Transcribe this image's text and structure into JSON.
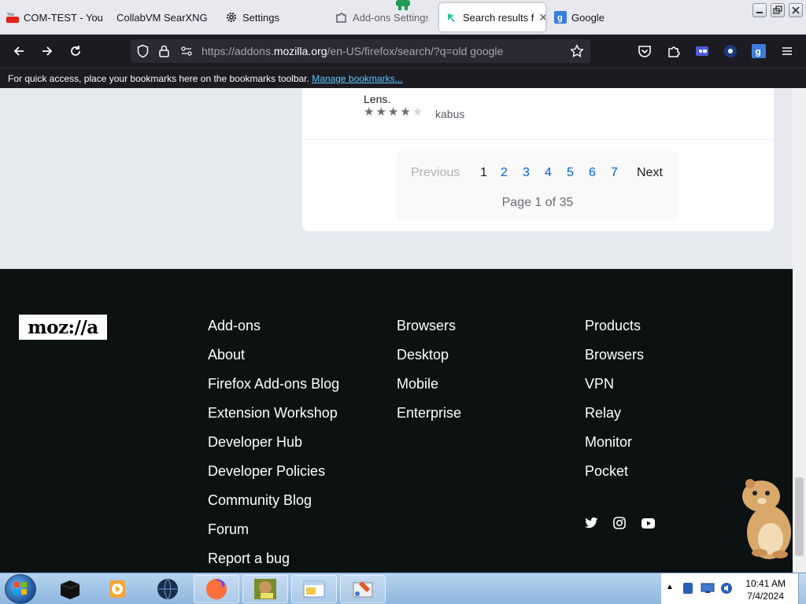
{
  "browser": {
    "tabs": [
      {
        "title": "COM-TEST - You",
        "active": false,
        "favicon": "youtube-icon"
      },
      {
        "title": "CollabVM SearXNG",
        "active": false,
        "favicon": "searxng-icon"
      },
      {
        "title": "Settings",
        "active": false,
        "favicon": "gear-icon"
      },
      {
        "title": "Add-ons Settings",
        "active": false,
        "favicon": "puzzle-icon"
      },
      {
        "title": "Search results f",
        "active": true,
        "favicon": "addons-icon"
      },
      {
        "title": "Google",
        "active": false,
        "favicon": "google-icon"
      }
    ],
    "url": {
      "prefix": "https://addons.",
      "domain": "mozilla.org",
      "path": "/en-US/firefox/search/?q=old google"
    },
    "bookmarks_bar": {
      "message": "For quick access, place your bookmarks here on the bookmarks toolbar.",
      "link": "Manage bookmarks..."
    }
  },
  "result": {
    "description_tail": "Lens.",
    "rating": 4,
    "max_rating": 5,
    "author": "kabus"
  },
  "pagination": {
    "previous": "Previous",
    "current": "1",
    "pages": [
      "2",
      "3",
      "4",
      "5",
      "6",
      "7"
    ],
    "next": "Next",
    "info": "Page 1 of 35"
  },
  "footer": {
    "logo": "moz://a",
    "columns": [
      {
        "links": [
          "Add-ons",
          "About",
          "Firefox Add-ons Blog",
          "Extension Workshop",
          "Developer Hub",
          "Developer Policies",
          "Community Blog",
          "Forum",
          "Report a bug"
        ]
      },
      {
        "links": [
          "Browsers",
          "Desktop",
          "Mobile",
          "Enterprise"
        ]
      },
      {
        "links": [
          "Products",
          "Browsers",
          "VPN",
          "Relay",
          "Monitor",
          "Pocket"
        ]
      }
    ],
    "social": [
      "twitter-icon",
      "instagram-icon",
      "youtube-icon"
    ]
  },
  "taskbar": {
    "clock": {
      "time": "10:41 AM",
      "date": "7/4/2024"
    }
  },
  "colors": {
    "accent": "#0060df",
    "toolbar": "#1c1b22",
    "footer": "#0c1112"
  }
}
